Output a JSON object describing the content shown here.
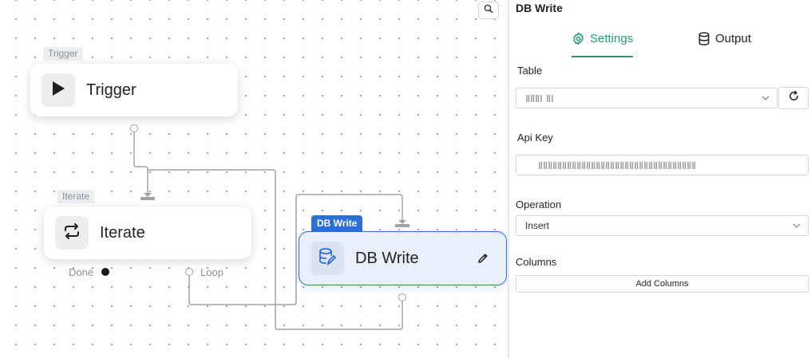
{
  "canvas": {
    "search_icon": "search-icon",
    "nodes": {
      "trigger": {
        "tag": "Trigger",
        "label": "Trigger",
        "icon": "play-icon"
      },
      "iterate": {
        "tag": "Iterate",
        "label": "Iterate",
        "icon": "repeat-icon",
        "ports": {
          "done": "Done",
          "loop": "Loop"
        }
      },
      "db_write": {
        "tag": "DB Write",
        "label": "DB Write",
        "icon": "database-edit-icon",
        "edit_icon": "pencil-icon"
      }
    }
  },
  "panel": {
    "title": "DB Write",
    "tabs": [
      {
        "label": "Settings",
        "icon": "gear-icon",
        "active": true
      },
      {
        "label": "Output",
        "icon": "database-icon",
        "active": false
      }
    ],
    "fields": {
      "table": {
        "label": "Table",
        "refresh_icon": "refresh-icon"
      },
      "api_key": {
        "label": "Api Key"
      },
      "operation": {
        "label": "Operation",
        "value": "Insert"
      },
      "columns": {
        "label": "Columns",
        "button_label": "Add Columns"
      }
    }
  },
  "colors": {
    "accent_green": "#1b9e6e",
    "selection_blue": "#2d6fd6"
  }
}
